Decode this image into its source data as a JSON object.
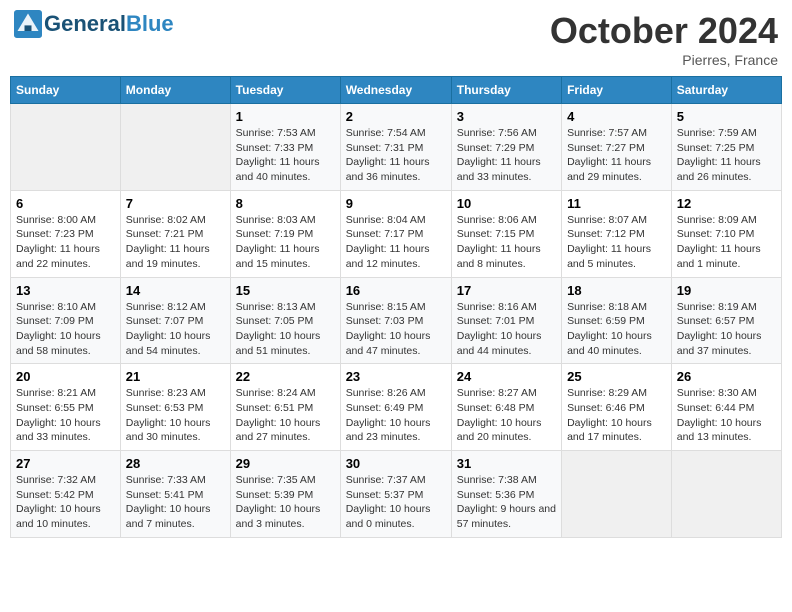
{
  "header": {
    "logo_line1": "General",
    "logo_line2": "Blue",
    "month": "October 2024",
    "location": "Pierres, France"
  },
  "days_of_week": [
    "Sunday",
    "Monday",
    "Tuesday",
    "Wednesday",
    "Thursday",
    "Friday",
    "Saturday"
  ],
  "weeks": [
    [
      {
        "day": "",
        "info": ""
      },
      {
        "day": "",
        "info": ""
      },
      {
        "day": "1",
        "info": "Sunrise: 7:53 AM\nSunset: 7:33 PM\nDaylight: 11 hours and 40 minutes."
      },
      {
        "day": "2",
        "info": "Sunrise: 7:54 AM\nSunset: 7:31 PM\nDaylight: 11 hours and 36 minutes."
      },
      {
        "day": "3",
        "info": "Sunrise: 7:56 AM\nSunset: 7:29 PM\nDaylight: 11 hours and 33 minutes."
      },
      {
        "day": "4",
        "info": "Sunrise: 7:57 AM\nSunset: 7:27 PM\nDaylight: 11 hours and 29 minutes."
      },
      {
        "day": "5",
        "info": "Sunrise: 7:59 AM\nSunset: 7:25 PM\nDaylight: 11 hours and 26 minutes."
      }
    ],
    [
      {
        "day": "6",
        "info": "Sunrise: 8:00 AM\nSunset: 7:23 PM\nDaylight: 11 hours and 22 minutes."
      },
      {
        "day": "7",
        "info": "Sunrise: 8:02 AM\nSunset: 7:21 PM\nDaylight: 11 hours and 19 minutes."
      },
      {
        "day": "8",
        "info": "Sunrise: 8:03 AM\nSunset: 7:19 PM\nDaylight: 11 hours and 15 minutes."
      },
      {
        "day": "9",
        "info": "Sunrise: 8:04 AM\nSunset: 7:17 PM\nDaylight: 11 hours and 12 minutes."
      },
      {
        "day": "10",
        "info": "Sunrise: 8:06 AM\nSunset: 7:15 PM\nDaylight: 11 hours and 8 minutes."
      },
      {
        "day": "11",
        "info": "Sunrise: 8:07 AM\nSunset: 7:12 PM\nDaylight: 11 hours and 5 minutes."
      },
      {
        "day": "12",
        "info": "Sunrise: 8:09 AM\nSunset: 7:10 PM\nDaylight: 11 hours and 1 minute."
      }
    ],
    [
      {
        "day": "13",
        "info": "Sunrise: 8:10 AM\nSunset: 7:09 PM\nDaylight: 10 hours and 58 minutes."
      },
      {
        "day": "14",
        "info": "Sunrise: 8:12 AM\nSunset: 7:07 PM\nDaylight: 10 hours and 54 minutes."
      },
      {
        "day": "15",
        "info": "Sunrise: 8:13 AM\nSunset: 7:05 PM\nDaylight: 10 hours and 51 minutes."
      },
      {
        "day": "16",
        "info": "Sunrise: 8:15 AM\nSunset: 7:03 PM\nDaylight: 10 hours and 47 minutes."
      },
      {
        "day": "17",
        "info": "Sunrise: 8:16 AM\nSunset: 7:01 PM\nDaylight: 10 hours and 44 minutes."
      },
      {
        "day": "18",
        "info": "Sunrise: 8:18 AM\nSunset: 6:59 PM\nDaylight: 10 hours and 40 minutes."
      },
      {
        "day": "19",
        "info": "Sunrise: 8:19 AM\nSunset: 6:57 PM\nDaylight: 10 hours and 37 minutes."
      }
    ],
    [
      {
        "day": "20",
        "info": "Sunrise: 8:21 AM\nSunset: 6:55 PM\nDaylight: 10 hours and 33 minutes."
      },
      {
        "day": "21",
        "info": "Sunrise: 8:23 AM\nSunset: 6:53 PM\nDaylight: 10 hours and 30 minutes."
      },
      {
        "day": "22",
        "info": "Sunrise: 8:24 AM\nSunset: 6:51 PM\nDaylight: 10 hours and 27 minutes."
      },
      {
        "day": "23",
        "info": "Sunrise: 8:26 AM\nSunset: 6:49 PM\nDaylight: 10 hours and 23 minutes."
      },
      {
        "day": "24",
        "info": "Sunrise: 8:27 AM\nSunset: 6:48 PM\nDaylight: 10 hours and 20 minutes."
      },
      {
        "day": "25",
        "info": "Sunrise: 8:29 AM\nSunset: 6:46 PM\nDaylight: 10 hours and 17 minutes."
      },
      {
        "day": "26",
        "info": "Sunrise: 8:30 AM\nSunset: 6:44 PM\nDaylight: 10 hours and 13 minutes."
      }
    ],
    [
      {
        "day": "27",
        "info": "Sunrise: 7:32 AM\nSunset: 5:42 PM\nDaylight: 10 hours and 10 minutes."
      },
      {
        "day": "28",
        "info": "Sunrise: 7:33 AM\nSunset: 5:41 PM\nDaylight: 10 hours and 7 minutes."
      },
      {
        "day": "29",
        "info": "Sunrise: 7:35 AM\nSunset: 5:39 PM\nDaylight: 10 hours and 3 minutes."
      },
      {
        "day": "30",
        "info": "Sunrise: 7:37 AM\nSunset: 5:37 PM\nDaylight: 10 hours and 0 minutes."
      },
      {
        "day": "31",
        "info": "Sunrise: 7:38 AM\nSunset: 5:36 PM\nDaylight: 9 hours and 57 minutes."
      },
      {
        "day": "",
        "info": ""
      },
      {
        "day": "",
        "info": ""
      }
    ]
  ]
}
